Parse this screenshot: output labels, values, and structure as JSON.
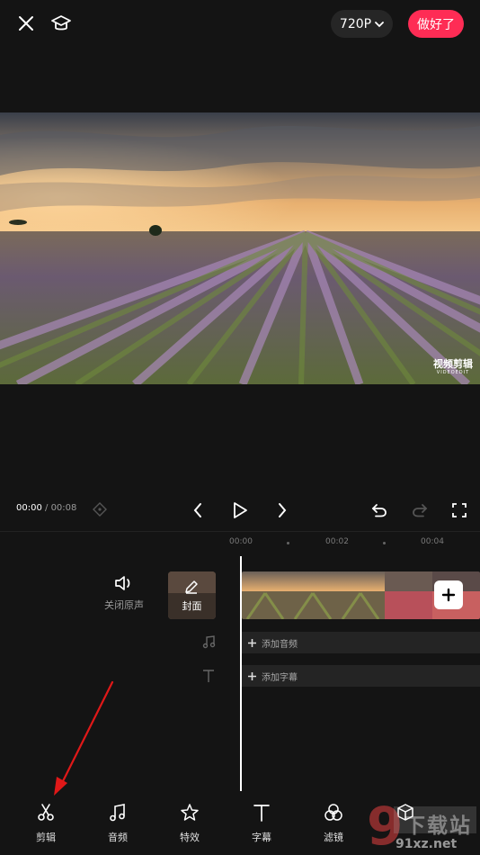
{
  "header": {
    "resolution": "720P",
    "done_label": "做好了"
  },
  "preview": {
    "watermark_title": "视频剪辑",
    "watermark_sub": "VIDEOEDIT"
  },
  "playback": {
    "current_time": "00:00",
    "separator": " / ",
    "total_time": "00:08"
  },
  "ruler": {
    "ticks": [
      "00:00",
      "00:02",
      "00:04"
    ]
  },
  "tracks": {
    "original_audio_label": "关闭原声",
    "cover_label": "封面",
    "add_audio_label": "添加音频",
    "add_subtitle_label": "添加字幕"
  },
  "toolbar": {
    "items": [
      {
        "label": "剪辑",
        "icon": "scissors-icon"
      },
      {
        "label": "音频",
        "icon": "music-note-icon"
      },
      {
        "label": "特效",
        "icon": "sparkle-star-icon"
      },
      {
        "label": "字幕",
        "icon": "text-t-icon"
      },
      {
        "label": "滤镜",
        "icon": "filter-circles-icon"
      }
    ]
  },
  "overlay": {
    "site_text": "9 下载站 91xz.net"
  },
  "colors": {
    "accent": "#fe2c55",
    "background": "#141414",
    "annotation_arrow": "#e01818"
  }
}
